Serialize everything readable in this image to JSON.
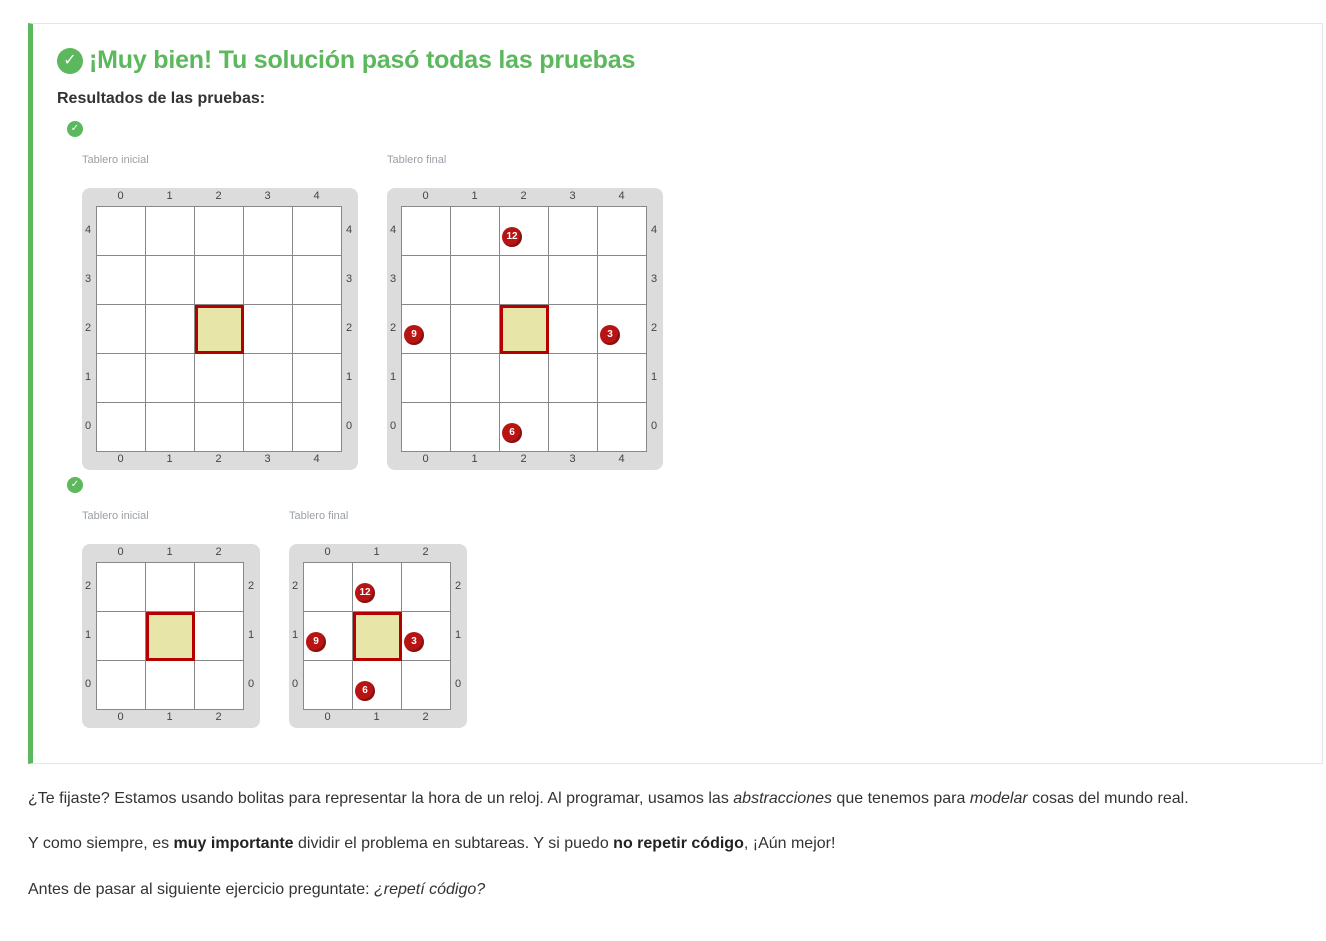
{
  "result": {
    "title": "¡Muy bien! Tu solución pasó todas las pruebas",
    "results_label": "Resultados de las pruebas:",
    "status_icon": "check-circle-icon",
    "status_color": "#5cb85c"
  },
  "tests": [
    {
      "initial_caption": "Tablero inicial",
      "final_caption": "Tablero final",
      "size": 5,
      "head": [
        2,
        2
      ],
      "initial_balls": [],
      "final_balls": [
        {
          "col": 2,
          "row": 4,
          "count": "12",
          "color": "red"
        },
        {
          "col": 0,
          "row": 2,
          "count": "9",
          "color": "red"
        },
        {
          "col": 4,
          "row": 2,
          "count": "3",
          "color": "red"
        },
        {
          "col": 2,
          "row": 0,
          "count": "6",
          "color": "red"
        }
      ],
      "coords": [
        "0",
        "1",
        "2",
        "3",
        "4"
      ]
    },
    {
      "initial_caption": "Tablero inicial",
      "final_caption": "Tablero final",
      "size": 3,
      "head": [
        1,
        1
      ],
      "initial_balls": [],
      "final_balls": [
        {
          "col": 1,
          "row": 2,
          "count": "12",
          "color": "red"
        },
        {
          "col": 0,
          "row": 1,
          "count": "9",
          "color": "red"
        },
        {
          "col": 2,
          "row": 1,
          "count": "3",
          "color": "red"
        },
        {
          "col": 1,
          "row": 0,
          "count": "6",
          "color": "red"
        }
      ],
      "coords": [
        "0",
        "1",
        "2"
      ]
    }
  ],
  "paragraphs": {
    "p1_a": "¿Te fijaste? Estamos usando bolitas para representar la hora de un reloj. Al programar, usamos las ",
    "p1_b": "abstracciones",
    "p1_c": " que tenemos para ",
    "p1_d": "modelar",
    "p1_e": " cosas del mundo real.",
    "p2_a": "Y como siempre, es ",
    "p2_b": "muy importante",
    "p2_c": " dividir el problema en subtareas. Y si puedo ",
    "p2_d": "no repetir código",
    "p2_e": ", ¡Aún mejor!",
    "p3_a": "Antes de pasar al siguiente ejercicio preguntate: ",
    "p3_b": "¿repetí código?"
  }
}
